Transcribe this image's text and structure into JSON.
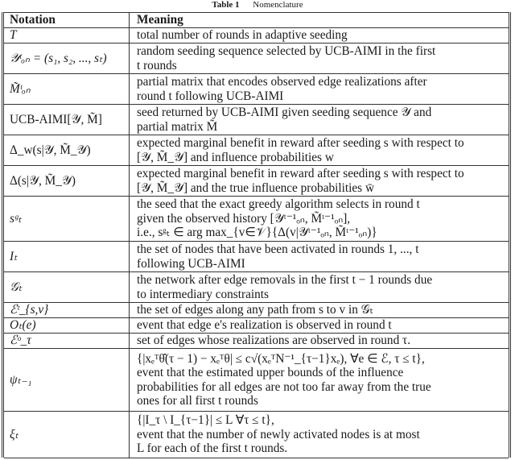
{
  "caption": {
    "label": "Table 1",
    "title": "Nomenclature"
  },
  "header": {
    "notation": "Notation",
    "meaning": "Meaning"
  },
  "rows": [
    {
      "notation": "T",
      "meaning": [
        "total number of rounds in adaptive seeding"
      ]
    },
    {
      "notation": "𝒴ᵗₒₙ = (s₁, s₂, ..., sₜ)",
      "meaning": [
        "random seeding sequence selected by UCB-AIMI in the first",
        "t rounds"
      ]
    },
    {
      "notation": "M̃ᵗₒₙ",
      "meaning": [
        "partial matrix that encodes observed edge realizations after",
        "round t following UCB-AIMI"
      ]
    },
    {
      "notation": "UCB-AIMI[𝒴, M̃]",
      "meaning": [
        "seed returned by UCB-AIMI given seeding sequence 𝒴 and",
        "partial matrix M̃"
      ]
    },
    {
      "notation": "Δ_w(s|𝒴, M̃_𝒴)",
      "meaning": [
        "expected marginal benefit in reward after seeding s with respect to",
        "[𝒴, M̃_𝒴] and influence probabilities w"
      ]
    },
    {
      "notation": "Δ(s|𝒴, M̃_𝒴)",
      "meaning": [
        "expected marginal benefit in reward after seeding s with respect to",
        "[𝒴, M̃_𝒴] and the true influence probabilities w̄"
      ]
    },
    {
      "notation": "sᵍₜ",
      "meaning": [
        "the seed that the exact greedy algorithm selects in round t",
        "given the observed history [𝒴ᵗ⁻¹ₒₙ, M̃ᵗ⁻¹ₒₙ],",
        "i.e., sᵍₜ ∈ arg max_{v∈𝒱}{Δ(v|𝒴ᵗ⁻¹ₒₙ, M̃ᵗ⁻¹ₒₙ)}"
      ]
    },
    {
      "notation": "Iₜ",
      "meaning": [
        "the set of nodes that have been activated in rounds 1, ..., t",
        "following UCB-AIMI"
      ]
    },
    {
      "notation": "𝒢ₜ",
      "meaning": [
        "the network after edge removals in the first t − 1 rounds due",
        "to intermediary constraints"
      ]
    },
    {
      "notation": "ℰᵗ_{s,v}",
      "meaning": [
        "the set of edges along any path from s to v in 𝒢ₜ"
      ]
    },
    {
      "notation": "Oₜ(e)",
      "meaning": [
        "event that edge e's realization is observed in round t"
      ]
    },
    {
      "notation": "ℰᵒ_τ",
      "meaning": [
        "set of edges whose realizations are observed in round τ."
      ]
    },
    {
      "notation": "ψₜ₋₁",
      "meaning": [
        "{|xₑᵀθ̂(τ − 1) − xₑᵀθ| ≤ c√(xₑᵀN⁻¹_{τ−1}xₑ), ∀e ∈ ℰ, τ ≤ t},",
        "event that the estimated upper bounds of the influence",
        "probabilities for all edges are not too far away from the true",
        "ones for all first t rounds"
      ]
    },
    {
      "notation": "ξₜ",
      "meaning": [
        "{|I_τ \\ I_{τ−1}| ≤ L ∀τ ≤ t},",
        "event that the number of newly activated nodes is at most",
        "L for each of the first t rounds."
      ]
    }
  ]
}
